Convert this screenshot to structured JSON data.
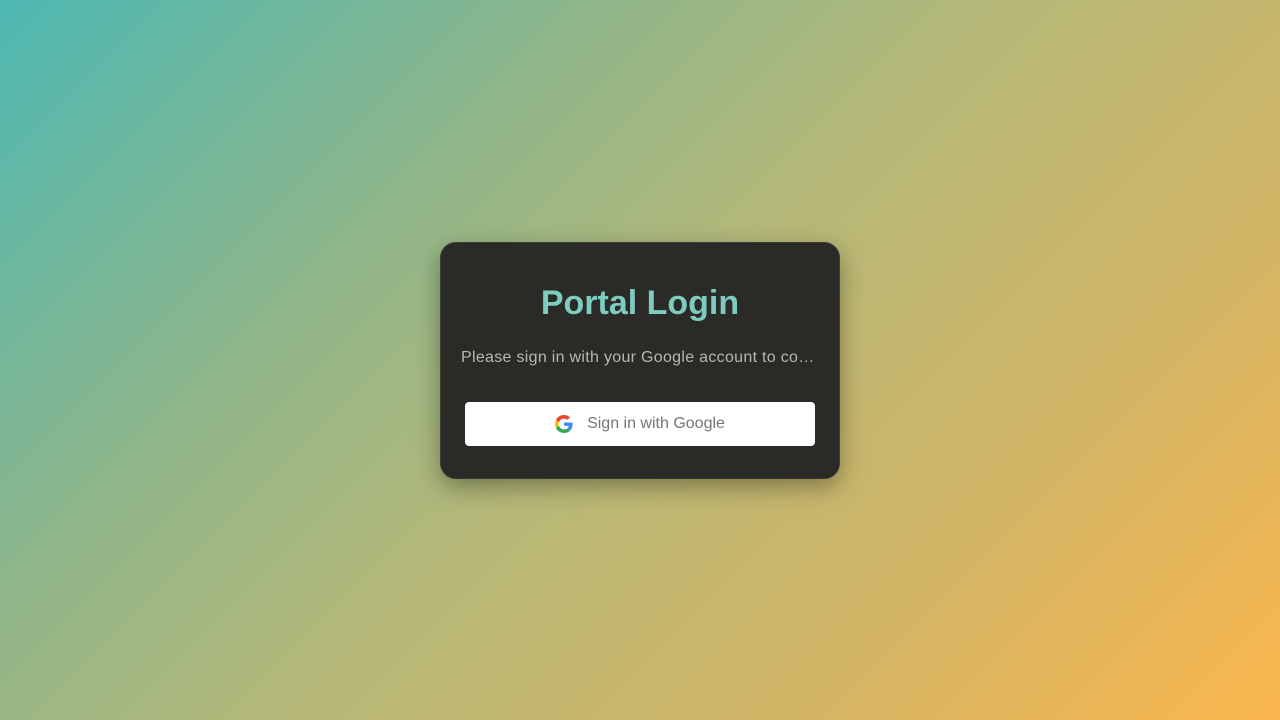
{
  "login_card": {
    "title": "Portal Login",
    "subtitle": "Please sign in with your Google account to continue",
    "google_button": {
      "label": "Sign in with Google",
      "icon": "google-icon"
    }
  },
  "colors": {
    "title": "#7ecbc0",
    "card_background": "#2a2a26",
    "gradient_start": "#4db8b2",
    "gradient_end": "#fbb64d"
  }
}
